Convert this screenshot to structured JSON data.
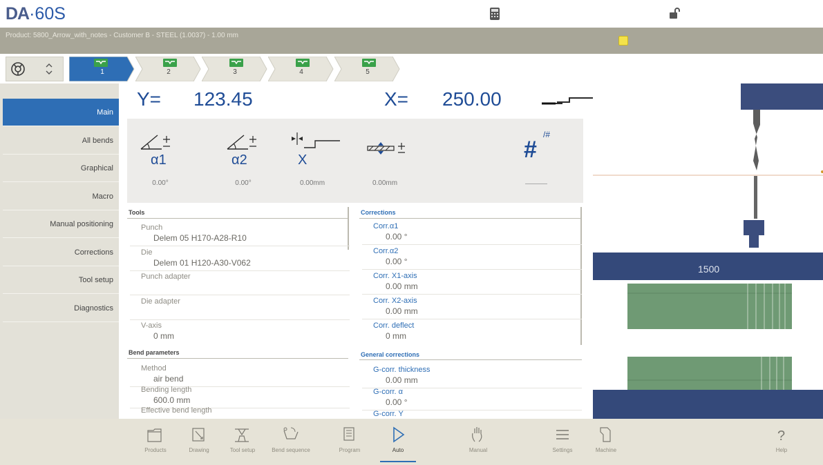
{
  "app": {
    "brand": "DA",
    "model": "·60S"
  },
  "product_bar": {
    "text": "Product: 5800_Arrow_with_notes - Customer B - STEEL (1.0037) - 1.00 mm"
  },
  "steps": [
    {
      "num": "1",
      "active": true
    },
    {
      "num": "2",
      "active": false
    },
    {
      "num": "3",
      "active": false
    },
    {
      "num": "4",
      "active": false
    },
    {
      "num": "5",
      "active": false
    }
  ],
  "nav": {
    "items": [
      "Main",
      "All bends",
      "Graphical",
      "Macro",
      "Manual positioning",
      "Corrections",
      "Tool setup",
      "Diagnostics"
    ],
    "active_index": 0
  },
  "readout": {
    "y_label": "Y=",
    "y_value": "123.45",
    "x_label": "X=",
    "x_value": "250.00"
  },
  "axis_panel": {
    "a1_label": "α1",
    "a1_value": "0.00°",
    "a2_label": "α2",
    "a2_value": "0.00°",
    "x_label": "X",
    "x_value": "0.00mm",
    "crown_value": "0.00mm",
    "count_symbol": "#",
    "count_super": "/#"
  },
  "tools": {
    "header": "Tools",
    "rows": [
      {
        "label": "Punch",
        "value": "Delem 05 H170-A28-R10"
      },
      {
        "label": "Die",
        "value": "Delem 01 H120-A30-V062"
      },
      {
        "label": "Punch adapter",
        "value": ""
      },
      {
        "label": "Die adapter",
        "value": ""
      },
      {
        "label": "V-axis",
        "value": "0 mm"
      }
    ]
  },
  "bend_parameters": {
    "header": "Bend parameters",
    "rows": [
      {
        "label": "Method",
        "value": "air bend"
      },
      {
        "label": "Bending length",
        "value": "600.0 mm"
      },
      {
        "label": "Effective bend length",
        "value": ""
      }
    ]
  },
  "corrections": {
    "header": "Corrections",
    "rows": [
      {
        "label": "Corr.α1",
        "value": "0.00 °"
      },
      {
        "label": "Corr.α2",
        "value": "0.00 °"
      },
      {
        "label": "Corr. X1-axis",
        "value": "0.00 mm"
      },
      {
        "label": "Corr. X2-axis",
        "value": "0.00 mm"
      },
      {
        "label": "Corr. deflect",
        "value": "0 mm"
      }
    ]
  },
  "general_corrections": {
    "header": "General corrections",
    "rows": [
      {
        "label": "G-corr. thickness",
        "value": "0.00 mm"
      },
      {
        "label": "G-corr. α",
        "value": "0.00 °"
      },
      {
        "label": "G-corr. Y",
        "value": ""
      }
    ]
  },
  "graphic": {
    "bar_value": "1500"
  },
  "toolbar": {
    "items": [
      {
        "label": "Products",
        "icon": "folder-icon"
      },
      {
        "label": "Drawing",
        "icon": "drawing-icon"
      },
      {
        "label": "Tool setup",
        "icon": "tool-setup-icon"
      },
      {
        "label": "Bend sequence",
        "icon": "bend-sequence-icon"
      },
      {
        "label": "Program",
        "icon": "program-icon"
      },
      {
        "label": "Auto",
        "icon": "play-icon"
      },
      {
        "label": "Manual",
        "icon": "hand-icon"
      },
      {
        "label": "Settings",
        "icon": "settings-list-icon"
      },
      {
        "label": "Machine",
        "icon": "machine-icon"
      },
      {
        "label": "Help",
        "icon": "help-icon"
      }
    ],
    "active_label": "Auto"
  },
  "colors": {
    "accent": "#2e6eb5",
    "step_marker": "#3aa14a",
    "nav_bg": "#e3e1d8",
    "tool_green": "#6f9a74",
    "graphic_bar": "#34497a"
  }
}
